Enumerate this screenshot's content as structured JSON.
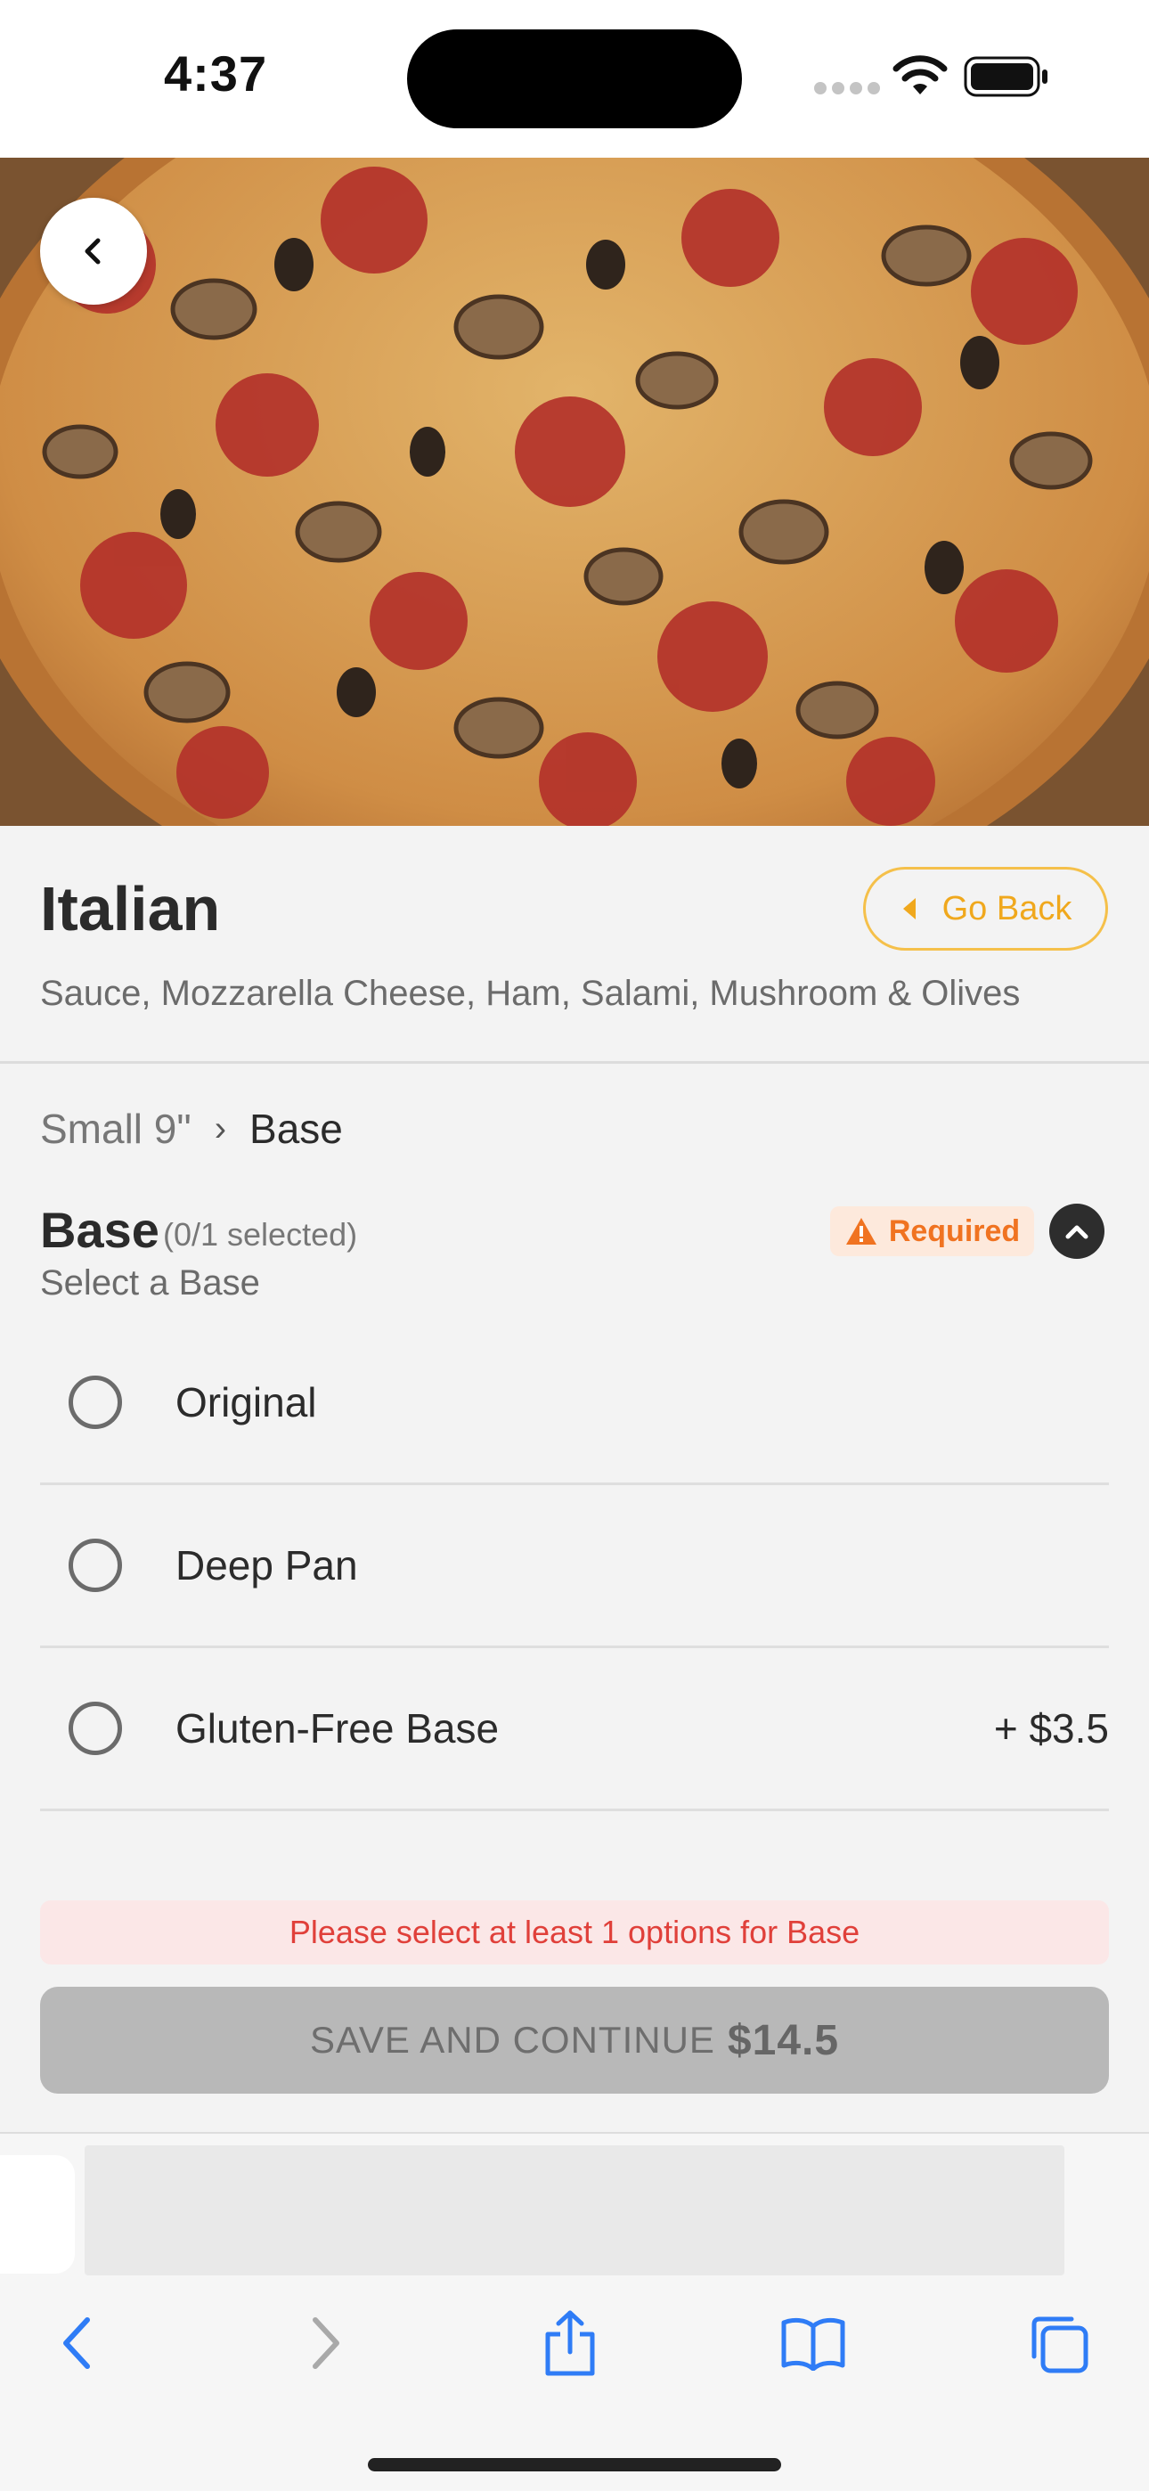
{
  "status_bar": {
    "time": "4:37"
  },
  "product": {
    "title": "Italian",
    "description": "Sauce, Mozzarella Cheese, Ham, Salami, Mushroom & Olives",
    "go_back_label": "Go Back"
  },
  "breadcrumb": {
    "parent": "Small 9\"",
    "separator": "›",
    "current": "Base"
  },
  "section": {
    "title": "Base",
    "selection_count": "(0/1 selected)",
    "subtitle": "Select a Base",
    "required_label": "Required"
  },
  "options": [
    {
      "label": "Original",
      "price": ""
    },
    {
      "label": "Deep Pan",
      "price": ""
    },
    {
      "label": "Gluten-Free Base",
      "price": "+ $3.5"
    }
  ],
  "error_message": "Please select at least 1 options for Base",
  "cta": {
    "label": "SAVE AND CONTINUE",
    "price": "$14.5"
  },
  "colors": {
    "accent": "#f0a81d",
    "required": "#f07321",
    "error": "#e0403a",
    "link_blue": "#2f7cf6"
  }
}
